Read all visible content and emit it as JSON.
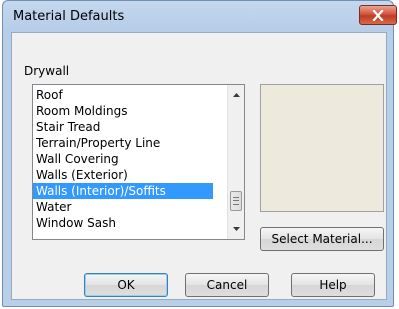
{
  "window": {
    "title": "Material Defaults",
    "close_icon": "close-x-icon"
  },
  "group": {
    "label": "Drywall"
  },
  "list": {
    "items": [
      "Roof",
      "Room Moldings",
      "Stair Tread",
      "Terrain/Property Line",
      "Wall Covering",
      "Walls (Exterior)",
      "Walls (Interior)/Soffits",
      "Water",
      "Window Sash"
    ],
    "selected_index": 6,
    "scroll_up_icon": "scroll-up-arrow-icon",
    "scroll_down_icon": "scroll-down-arrow-icon"
  },
  "preview": {
    "color": "#ede9dc"
  },
  "buttons": {
    "select_material": "Select Material...",
    "ok": "OK",
    "cancel": "Cancel",
    "help": "Help"
  },
  "colors": {
    "selection": "#3399ff",
    "close_button": "#c94a32"
  }
}
